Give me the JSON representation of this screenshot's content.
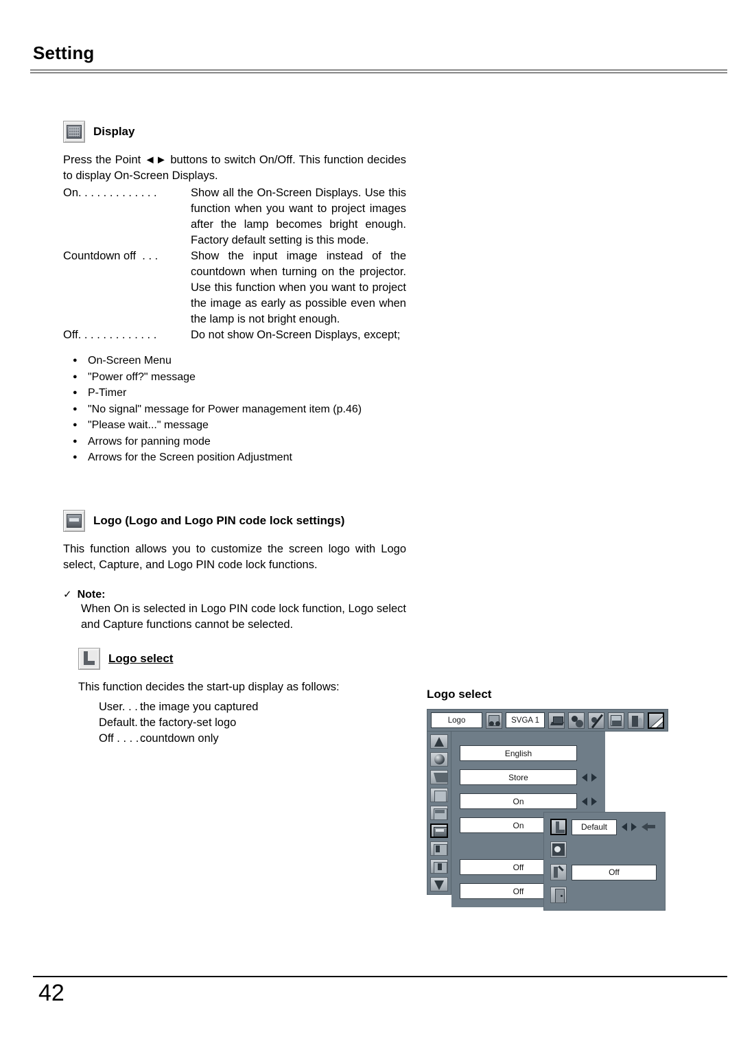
{
  "header": {
    "title": "Setting"
  },
  "footer": {
    "page_number": "42"
  },
  "display_section": {
    "icon": "display-icon",
    "heading": "Display",
    "intro": "Press the Point ◄► buttons to switch On/Off. This function decides to display On-Screen Displays.",
    "definitions": [
      {
        "term": "On. . . . . . . . . . . . .",
        "desc": "Show all the On-Screen Displays. Use this function when you want to project images after the lamp becomes bright enough.  Factory default setting is this mode."
      },
      {
        "term": "Countdown off  . . .",
        "desc": "Show the input image instead of the countdown when turning on the projector.  Use this function when you want to project the image as early as possible even when the lamp is not bright enough."
      },
      {
        "term": "Off. . . . . . . . . . . . .",
        "desc": "Do not show On-Screen Displays, except;"
      }
    ],
    "bullets": [
      "On-Screen Menu",
      "\"Power off?\" message",
      "P-Timer",
      "\"No signal\" message for Power management item (p.46)",
      "\"Please wait...\" message",
      "Arrows for panning mode",
      "Arrows for the Screen position Adjustment"
    ]
  },
  "logo_section": {
    "icon": "logo-icon",
    "heading": "Logo (Logo and Logo PIN code lock settings)",
    "body": "This function allows you to customize the screen logo with Logo select, Capture, and Logo PIN code lock functions."
  },
  "note": {
    "check_glyph": "✓",
    "label": "Note:",
    "body": "When On is selected in Logo PIN code lock function, Logo select and Capture functions cannot be selected."
  },
  "logo_select_section": {
    "icon": "logo-select-icon",
    "heading": "Logo select",
    "intro": "This function decides the start-up display as follows:",
    "options": [
      {
        "term": "User. . . .",
        "desc": "the image you captured"
      },
      {
        "term": "Default. .",
        "desc": "the factory-set logo"
      },
      {
        "term": "Off . . . . .",
        "desc": "countdown only"
      }
    ]
  },
  "osd": {
    "caption": "Logo select",
    "topbar": {
      "menu_label": "Logo",
      "tuner_icon": "tuner-icon",
      "source_label": "SVGA 1",
      "tabs": [
        {
          "icon": "computer-input-icon",
          "selected": false
        },
        {
          "icon": "color-adjust-icon",
          "selected": false
        },
        {
          "icon": "image-adjust-icon",
          "selected": false
        },
        {
          "icon": "screen-size-icon",
          "selected": false
        },
        {
          "icon": "sound-icon",
          "selected": false
        },
        {
          "icon": "setting-pencil-icon",
          "selected": true
        }
      ]
    },
    "sidebar": [
      {
        "icon": "scroll-up-icon",
        "selected": false
      },
      {
        "icon": "language-globe-icon",
        "selected": false
      },
      {
        "icon": "keystone-icon",
        "selected": false
      },
      {
        "icon": "blue-back-icon",
        "selected": false
      },
      {
        "icon": "display-icon",
        "selected": false
      },
      {
        "icon": "logo-icon",
        "selected": true
      },
      {
        "icon": "ceiling-icon",
        "selected": false
      },
      {
        "icon": "rear-icon",
        "selected": false
      },
      {
        "icon": "scroll-down-icon",
        "selected": false
      }
    ],
    "items": [
      {
        "value": "English",
        "arrows": false
      },
      {
        "value": "Store",
        "arrows": true
      },
      {
        "value": "On",
        "arrows": true
      },
      {
        "value": "On",
        "arrows": true
      },
      {
        "value": "Off",
        "arrows": true
      },
      {
        "value": "Off",
        "arrows": true
      }
    ],
    "submenu": [
      {
        "icon": "logo-select-icon",
        "value": "Default",
        "arrows": true,
        "cursor": true,
        "selected": true
      },
      {
        "icon": "capture-icon",
        "value": "",
        "arrows": false,
        "cursor": false,
        "selected": false
      },
      {
        "icon": "pin-code-lock-icon",
        "value": "Off",
        "arrows": false,
        "cursor": false,
        "selected": false
      },
      {
        "icon": "quit-icon",
        "value": "",
        "arrows": false,
        "cursor": false,
        "selected": false
      }
    ]
  }
}
